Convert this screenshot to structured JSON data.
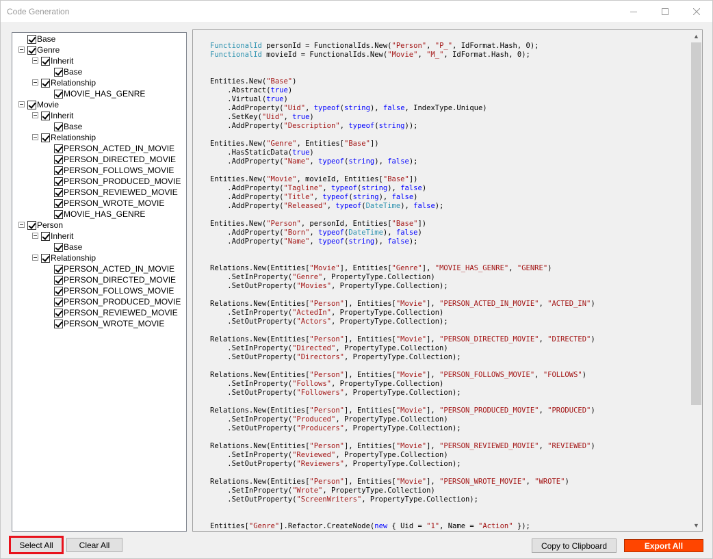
{
  "window": {
    "title": "Code Generation"
  },
  "tree": {
    "nodes": [
      {
        "label": "Base",
        "level": 0,
        "expander": false
      },
      {
        "label": "Genre",
        "level": 0,
        "expander": true
      },
      {
        "label": "Inherit",
        "level": 1,
        "expander": true
      },
      {
        "label": "Base",
        "level": 2,
        "expander": false
      },
      {
        "label": "Relationship",
        "level": 1,
        "expander": true
      },
      {
        "label": "MOVIE_HAS_GENRE",
        "level": 2,
        "expander": false
      },
      {
        "label": "Movie",
        "level": 0,
        "expander": true
      },
      {
        "label": "Inherit",
        "level": 1,
        "expander": true
      },
      {
        "label": "Base",
        "level": 2,
        "expander": false
      },
      {
        "label": "Relationship",
        "level": 1,
        "expander": true
      },
      {
        "label": "PERSON_ACTED_IN_MOVIE",
        "level": 2,
        "expander": false
      },
      {
        "label": "PERSON_DIRECTED_MOVIE",
        "level": 2,
        "expander": false
      },
      {
        "label": "PERSON_FOLLOWS_MOVIE",
        "level": 2,
        "expander": false
      },
      {
        "label": "PERSON_PRODUCED_MOVIE",
        "level": 2,
        "expander": false
      },
      {
        "label": "PERSON_REVIEWED_MOVIE",
        "level": 2,
        "expander": false
      },
      {
        "label": "PERSON_WROTE_MOVIE",
        "level": 2,
        "expander": false
      },
      {
        "label": "MOVIE_HAS_GENRE",
        "level": 2,
        "expander": false
      },
      {
        "label": "Person",
        "level": 0,
        "expander": true
      },
      {
        "label": "Inherit",
        "level": 1,
        "expander": true
      },
      {
        "label": "Base",
        "level": 2,
        "expander": false
      },
      {
        "label": "Relationship",
        "level": 1,
        "expander": true
      },
      {
        "label": "PERSON_ACTED_IN_MOVIE",
        "level": 2,
        "expander": false
      },
      {
        "label": "PERSON_DIRECTED_MOVIE",
        "level": 2,
        "expander": false
      },
      {
        "label": "PERSON_FOLLOWS_MOVIE",
        "level": 2,
        "expander": false
      },
      {
        "label": "PERSON_PRODUCED_MOVIE",
        "level": 2,
        "expander": false
      },
      {
        "label": "PERSON_REVIEWED_MOVIE",
        "level": 2,
        "expander": false
      },
      {
        "label": "PERSON_WROTE_MOVIE",
        "level": 2,
        "expander": false
      }
    ]
  },
  "code": {
    "lines": [
      [
        [
          "t",
          "FunctionalId"
        ],
        [
          "p",
          " personId = FunctionalIds.New("
        ],
        [
          "s",
          "\"Person\""
        ],
        [
          "p",
          ", "
        ],
        [
          "s",
          "\"P_\""
        ],
        [
          "p",
          ", IdFormat.Hash, 0);"
        ]
      ],
      [
        [
          "t",
          "FunctionalId"
        ],
        [
          "p",
          " movieId = FunctionalIds.New("
        ],
        [
          "s",
          "\"Movie\""
        ],
        [
          "p",
          ", "
        ],
        [
          "s",
          "\"M_\""
        ],
        [
          "p",
          ", IdFormat.Hash, 0);"
        ]
      ],
      [],
      [],
      [
        [
          "p",
          "Entities.New("
        ],
        [
          "s",
          "\"Base\""
        ],
        [
          "p",
          ")"
        ]
      ],
      [
        [
          "p",
          "    .Abstract("
        ],
        [
          "k",
          "true"
        ],
        [
          "p",
          ")"
        ]
      ],
      [
        [
          "p",
          "    .Virtual("
        ],
        [
          "k",
          "true"
        ],
        [
          "p",
          ")"
        ]
      ],
      [
        [
          "p",
          "    .AddProperty("
        ],
        [
          "s",
          "\"Uid\""
        ],
        [
          "p",
          ", "
        ],
        [
          "k",
          "typeof"
        ],
        [
          "p",
          "("
        ],
        [
          "k",
          "string"
        ],
        [
          "p",
          "), "
        ],
        [
          "k",
          "false"
        ],
        [
          "p",
          ", IndexType.Unique)"
        ]
      ],
      [
        [
          "p",
          "    .SetKey("
        ],
        [
          "s",
          "\"Uid\""
        ],
        [
          "p",
          ", "
        ],
        [
          "k",
          "true"
        ],
        [
          "p",
          ")"
        ]
      ],
      [
        [
          "p",
          "    .AddProperty("
        ],
        [
          "s",
          "\"Description\""
        ],
        [
          "p",
          ", "
        ],
        [
          "k",
          "typeof"
        ],
        [
          "p",
          "("
        ],
        [
          "k",
          "string"
        ],
        [
          "p",
          "));"
        ]
      ],
      [],
      [
        [
          "p",
          "Entities.New("
        ],
        [
          "s",
          "\"Genre\""
        ],
        [
          "p",
          ", Entities["
        ],
        [
          "s",
          "\"Base\""
        ],
        [
          "p",
          "])"
        ]
      ],
      [
        [
          "p",
          "    .HasStaticData("
        ],
        [
          "k",
          "true"
        ],
        [
          "p",
          ")"
        ]
      ],
      [
        [
          "p",
          "    .AddProperty("
        ],
        [
          "s",
          "\"Name\""
        ],
        [
          "p",
          ", "
        ],
        [
          "k",
          "typeof"
        ],
        [
          "p",
          "("
        ],
        [
          "k",
          "string"
        ],
        [
          "p",
          "), "
        ],
        [
          "k",
          "false"
        ],
        [
          "p",
          ");"
        ]
      ],
      [],
      [
        [
          "p",
          "Entities.New("
        ],
        [
          "s",
          "\"Movie\""
        ],
        [
          "p",
          ", movieId, Entities["
        ],
        [
          "s",
          "\"Base\""
        ],
        [
          "p",
          "])"
        ]
      ],
      [
        [
          "p",
          "    .AddProperty("
        ],
        [
          "s",
          "\"Tagline\""
        ],
        [
          "p",
          ", "
        ],
        [
          "k",
          "typeof"
        ],
        [
          "p",
          "("
        ],
        [
          "k",
          "string"
        ],
        [
          "p",
          "), "
        ],
        [
          "k",
          "false"
        ],
        [
          "p",
          ")"
        ]
      ],
      [
        [
          "p",
          "    .AddProperty("
        ],
        [
          "s",
          "\"Title\""
        ],
        [
          "p",
          ", "
        ],
        [
          "k",
          "typeof"
        ],
        [
          "p",
          "("
        ],
        [
          "k",
          "string"
        ],
        [
          "p",
          "), "
        ],
        [
          "k",
          "false"
        ],
        [
          "p",
          ")"
        ]
      ],
      [
        [
          "p",
          "    .AddProperty("
        ],
        [
          "s",
          "\"Released\""
        ],
        [
          "p",
          ", "
        ],
        [
          "k",
          "typeof"
        ],
        [
          "p",
          "("
        ],
        [
          "t",
          "DateTime"
        ],
        [
          "p",
          "), "
        ],
        [
          "k",
          "false"
        ],
        [
          "p",
          ");"
        ]
      ],
      [],
      [
        [
          "p",
          "Entities.New("
        ],
        [
          "s",
          "\"Person\""
        ],
        [
          "p",
          ", personId, Entities["
        ],
        [
          "s",
          "\"Base\""
        ],
        [
          "p",
          "])"
        ]
      ],
      [
        [
          "p",
          "    .AddProperty("
        ],
        [
          "s",
          "\"Born\""
        ],
        [
          "p",
          ", "
        ],
        [
          "k",
          "typeof"
        ],
        [
          "p",
          "("
        ],
        [
          "t",
          "DateTime"
        ],
        [
          "p",
          "), "
        ],
        [
          "k",
          "false"
        ],
        [
          "p",
          ")"
        ]
      ],
      [
        [
          "p",
          "    .AddProperty("
        ],
        [
          "s",
          "\"Name\""
        ],
        [
          "p",
          ", "
        ],
        [
          "k",
          "typeof"
        ],
        [
          "p",
          "("
        ],
        [
          "k",
          "string"
        ],
        [
          "p",
          "), "
        ],
        [
          "k",
          "false"
        ],
        [
          "p",
          ");"
        ]
      ],
      [],
      [],
      [
        [
          "p",
          "Relations.New(Entities["
        ],
        [
          "s",
          "\"Movie\""
        ],
        [
          "p",
          "], Entities["
        ],
        [
          "s",
          "\"Genre\""
        ],
        [
          "p",
          "], "
        ],
        [
          "s",
          "\"MOVIE_HAS_GENRE\""
        ],
        [
          "p",
          ", "
        ],
        [
          "s",
          "\"GENRE\""
        ],
        [
          "p",
          ")"
        ]
      ],
      [
        [
          "p",
          "    .SetInProperty("
        ],
        [
          "s",
          "\"Genre\""
        ],
        [
          "p",
          ", PropertyType.Collection)"
        ]
      ],
      [
        [
          "p",
          "    .SetOutProperty("
        ],
        [
          "s",
          "\"Movies\""
        ],
        [
          "p",
          ", PropertyType.Collection);"
        ]
      ],
      [],
      [
        [
          "p",
          "Relations.New(Entities["
        ],
        [
          "s",
          "\"Person\""
        ],
        [
          "p",
          "], Entities["
        ],
        [
          "s",
          "\"Movie\""
        ],
        [
          "p",
          "], "
        ],
        [
          "s",
          "\"PERSON_ACTED_IN_MOVIE\""
        ],
        [
          "p",
          ", "
        ],
        [
          "s",
          "\"ACTED_IN\""
        ],
        [
          "p",
          ")"
        ]
      ],
      [
        [
          "p",
          "    .SetInProperty("
        ],
        [
          "s",
          "\"ActedIn\""
        ],
        [
          "p",
          ", PropertyType.Collection)"
        ]
      ],
      [
        [
          "p",
          "    .SetOutProperty("
        ],
        [
          "s",
          "\"Actors\""
        ],
        [
          "p",
          ", PropertyType.Collection);"
        ]
      ],
      [],
      [
        [
          "p",
          "Relations.New(Entities["
        ],
        [
          "s",
          "\"Person\""
        ],
        [
          "p",
          "], Entities["
        ],
        [
          "s",
          "\"Movie\""
        ],
        [
          "p",
          "], "
        ],
        [
          "s",
          "\"PERSON_DIRECTED_MOVIE\""
        ],
        [
          "p",
          ", "
        ],
        [
          "s",
          "\"DIRECTED\""
        ],
        [
          "p",
          ")"
        ]
      ],
      [
        [
          "p",
          "    .SetInProperty("
        ],
        [
          "s",
          "\"Directed\""
        ],
        [
          "p",
          ", PropertyType.Collection)"
        ]
      ],
      [
        [
          "p",
          "    .SetOutProperty("
        ],
        [
          "s",
          "\"Directors\""
        ],
        [
          "p",
          ", PropertyType.Collection);"
        ]
      ],
      [],
      [
        [
          "p",
          "Relations.New(Entities["
        ],
        [
          "s",
          "\"Person\""
        ],
        [
          "p",
          "], Entities["
        ],
        [
          "s",
          "\"Movie\""
        ],
        [
          "p",
          "], "
        ],
        [
          "s",
          "\"PERSON_FOLLOWS_MOVIE\""
        ],
        [
          "p",
          ", "
        ],
        [
          "s",
          "\"FOLLOWS\""
        ],
        [
          "p",
          ")"
        ]
      ],
      [
        [
          "p",
          "    .SetInProperty("
        ],
        [
          "s",
          "\"Follows\""
        ],
        [
          "p",
          ", PropertyType.Collection)"
        ]
      ],
      [
        [
          "p",
          "    .SetOutProperty("
        ],
        [
          "s",
          "\"Followers\""
        ],
        [
          "p",
          ", PropertyType.Collection);"
        ]
      ],
      [],
      [
        [
          "p",
          "Relations.New(Entities["
        ],
        [
          "s",
          "\"Person\""
        ],
        [
          "p",
          "], Entities["
        ],
        [
          "s",
          "\"Movie\""
        ],
        [
          "p",
          "], "
        ],
        [
          "s",
          "\"PERSON_PRODUCED_MOVIE\""
        ],
        [
          "p",
          ", "
        ],
        [
          "s",
          "\"PRODUCED\""
        ],
        [
          "p",
          ")"
        ]
      ],
      [
        [
          "p",
          "    .SetInProperty("
        ],
        [
          "s",
          "\"Produced\""
        ],
        [
          "p",
          ", PropertyType.Collection)"
        ]
      ],
      [
        [
          "p",
          "    .SetOutProperty("
        ],
        [
          "s",
          "\"Producers\""
        ],
        [
          "p",
          ", PropertyType.Collection);"
        ]
      ],
      [],
      [
        [
          "p",
          "Relations.New(Entities["
        ],
        [
          "s",
          "\"Person\""
        ],
        [
          "p",
          "], Entities["
        ],
        [
          "s",
          "\"Movie\""
        ],
        [
          "p",
          "], "
        ],
        [
          "s",
          "\"PERSON_REVIEWED_MOVIE\""
        ],
        [
          "p",
          ", "
        ],
        [
          "s",
          "\"REVIEWED\""
        ],
        [
          "p",
          ")"
        ]
      ],
      [
        [
          "p",
          "    .SetInProperty("
        ],
        [
          "s",
          "\"Reviewed\""
        ],
        [
          "p",
          ", PropertyType.Collection)"
        ]
      ],
      [
        [
          "p",
          "    .SetOutProperty("
        ],
        [
          "s",
          "\"Reviewers\""
        ],
        [
          "p",
          ", PropertyType.Collection);"
        ]
      ],
      [],
      [
        [
          "p",
          "Relations.New(Entities["
        ],
        [
          "s",
          "\"Person\""
        ],
        [
          "p",
          "], Entities["
        ],
        [
          "s",
          "\"Movie\""
        ],
        [
          "p",
          "], "
        ],
        [
          "s",
          "\"PERSON_WROTE_MOVIE\""
        ],
        [
          "p",
          ", "
        ],
        [
          "s",
          "\"WROTE\""
        ],
        [
          "p",
          ")"
        ]
      ],
      [
        [
          "p",
          "    .SetInProperty("
        ],
        [
          "s",
          "\"Wrote\""
        ],
        [
          "p",
          ", PropertyType.Collection)"
        ]
      ],
      [
        [
          "p",
          "    .SetOutProperty("
        ],
        [
          "s",
          "\"ScreenWriters\""
        ],
        [
          "p",
          ", PropertyType.Collection);"
        ]
      ],
      [],
      [],
      [
        [
          "p",
          "Entities["
        ],
        [
          "s",
          "\"Genre\""
        ],
        [
          "p",
          "].Refactor.CreateNode("
        ],
        [
          "k",
          "new"
        ],
        [
          "p",
          " { Uid = "
        ],
        [
          "s",
          "\"1\""
        ],
        [
          "p",
          ", Name = "
        ],
        [
          "s",
          "\"Action\""
        ],
        [
          "p",
          " });"
        ]
      ]
    ]
  },
  "buttons": {
    "select_all": "Select All",
    "clear_all": "Clear All",
    "copy": "Copy to Clipboard",
    "export": "Export All"
  },
  "colors": {
    "type": "#2b91af",
    "string": "#a31515",
    "keyword": "#0000ff",
    "export_button": "#ff4500",
    "highlight_border": "#e8121c"
  }
}
